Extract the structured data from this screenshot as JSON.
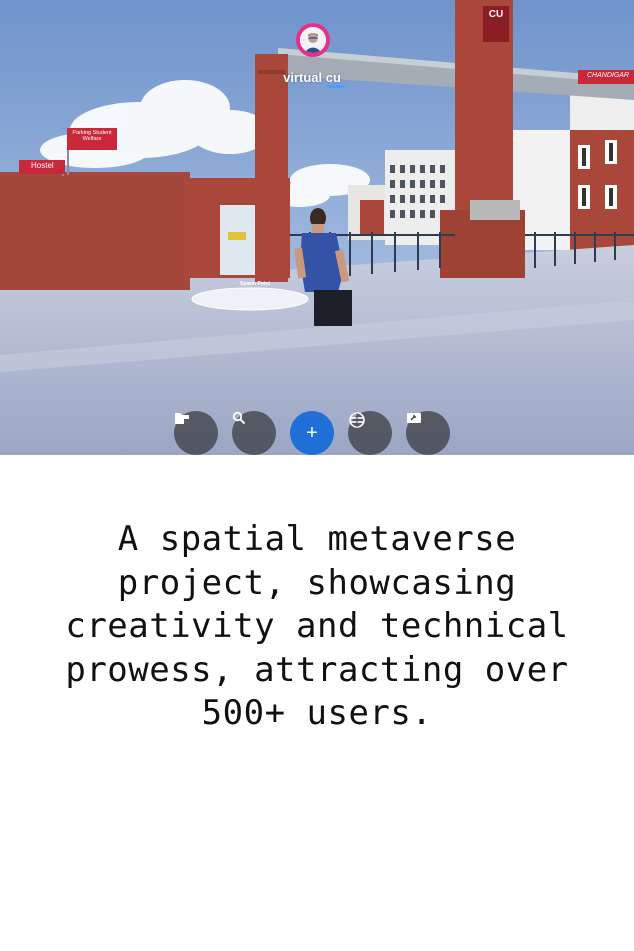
{
  "scene": {
    "user": {
      "name": "virtual cu"
    },
    "signs": {
      "parking": "Parking Student Welfare",
      "hostel": "Hostel",
      "cu": "CU",
      "chandigarh": "CHANDIGAR",
      "spawn_point": "Spawn Point"
    },
    "colors": {
      "sky": "#8fb0d8",
      "brick": "#a9483a",
      "ground": "#b7c0d8",
      "accent": "#1f6fd6"
    }
  },
  "toolbar": {
    "buttons": [
      {
        "icon": "folder-icon"
      },
      {
        "icon": "search-icon"
      },
      {
        "icon": "plus-icon",
        "label": "+"
      },
      {
        "icon": "hub-icon"
      },
      {
        "icon": "share-screen-icon"
      }
    ]
  },
  "caption": {
    "text": "A spatial metaverse project, showcasing creativity and technical prowess, attracting over 500+ users."
  }
}
